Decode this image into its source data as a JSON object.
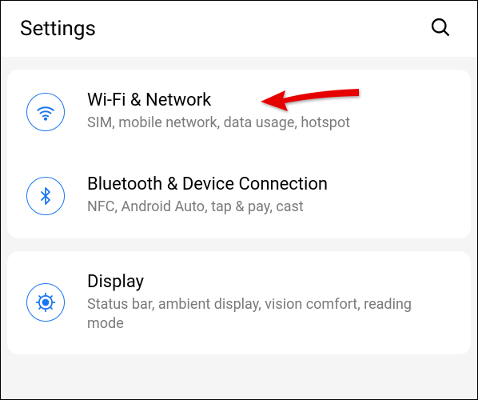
{
  "header": {
    "title": "Settings"
  },
  "groups": [
    {
      "items": [
        {
          "icon": "wifi",
          "title": "Wi-Fi & Network",
          "subtitle": "SIM, mobile network, data usage, hotspot"
        },
        {
          "icon": "bluetooth",
          "title": "Bluetooth & Device Connection",
          "subtitle": "NFC, Android Auto, tap & pay, cast"
        }
      ]
    },
    {
      "items": [
        {
          "icon": "display",
          "title": "Display",
          "subtitle": "Status bar, ambient display, vision comfort, reading mode"
        }
      ]
    }
  ]
}
